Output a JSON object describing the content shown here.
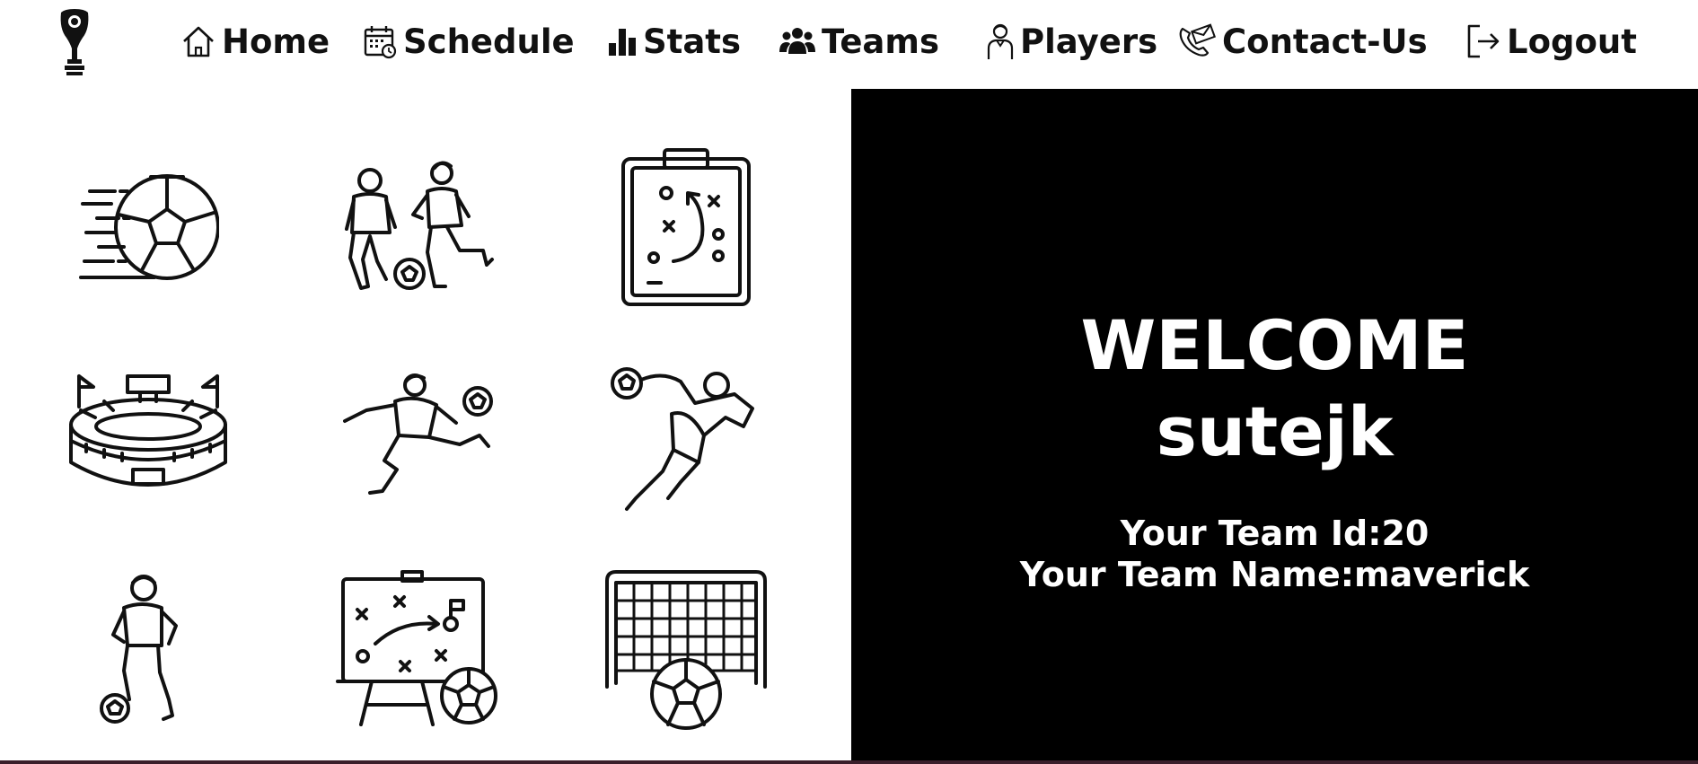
{
  "nav": {
    "home": "Home",
    "schedule": "Schedule",
    "stats": "Stats",
    "teams": "Teams",
    "players": "Players",
    "contact": "Contact-Us",
    "logout": "Logout"
  },
  "welcome": {
    "title": "WELCOME",
    "username": "sutejk",
    "team_id_line": "Your Team Id:20",
    "team_name_line": "Your Team Name:maverick"
  },
  "icons": [
    "fast-soccer-ball-icon",
    "two-players-dribbling-icon",
    "tactics-clipboard-icon",
    "stadium-icon",
    "player-kicking-icon",
    "goalkeeper-diving-icon",
    "player-with-ball-icon",
    "tactics-whiteboard-icon",
    "goal-net-icon"
  ],
  "colors": {
    "panel": "#000000",
    "text_on_panel": "#ffffff",
    "nav_text": "#111111"
  }
}
